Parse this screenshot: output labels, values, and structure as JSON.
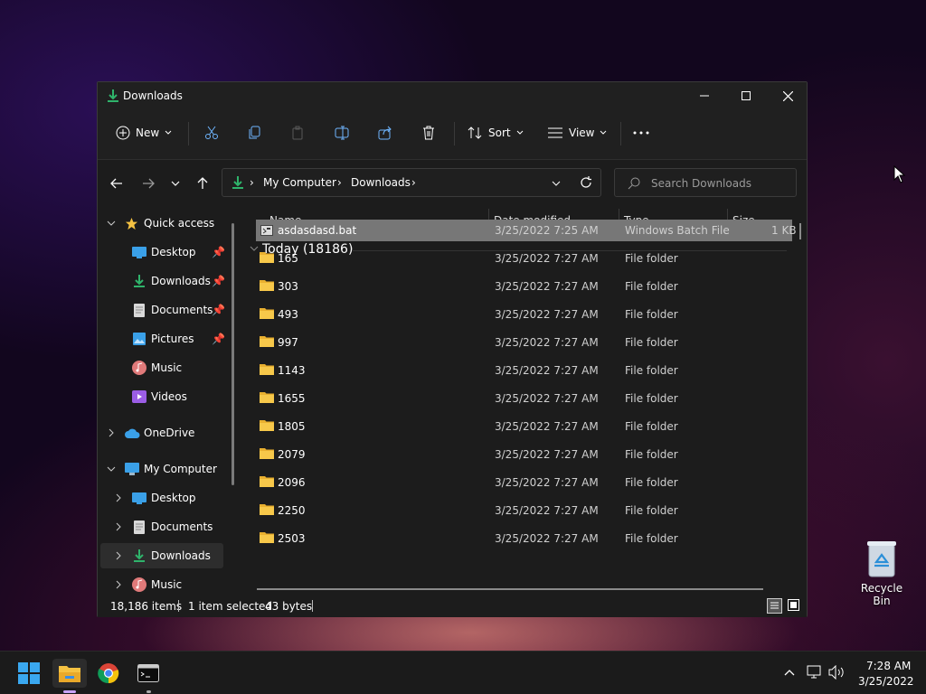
{
  "window": {
    "title": "Downloads"
  },
  "toolbar": {
    "new_label": "New",
    "sort_label": "Sort",
    "view_label": "View"
  },
  "address": {
    "segments": [
      "My Computer",
      "Downloads"
    ]
  },
  "search": {
    "placeholder": "Search Downloads"
  },
  "sidebar": {
    "quick_access": "Quick access",
    "items": [
      {
        "label": "Desktop",
        "pinned": true
      },
      {
        "label": "Downloads",
        "pinned": true
      },
      {
        "label": "Documents",
        "pinned": true
      },
      {
        "label": "Pictures",
        "pinned": true
      },
      {
        "label": "Music",
        "pinned": false
      },
      {
        "label": "Videos",
        "pinned": false
      }
    ],
    "onedrive": "OneDrive",
    "my_computer": "My Computer",
    "computer_items": [
      "Desktop",
      "Documents",
      "Downloads",
      "Music"
    ]
  },
  "columns": {
    "name": "Name",
    "date": "Date modified",
    "type": "Type",
    "size": "Size"
  },
  "group": {
    "title": "Today (18186)"
  },
  "files": [
    {
      "name": "asdasdasd.bat",
      "date": "3/25/2022 7:25 AM",
      "type": "Windows Batch File",
      "size": "1 KB"
    },
    {
      "name": "165",
      "date": "3/25/2022 7:27 AM",
      "type": "File folder",
      "size": ""
    },
    {
      "name": "303",
      "date": "3/25/2022 7:27 AM",
      "type": "File folder",
      "size": ""
    },
    {
      "name": "493",
      "date": "3/25/2022 7:27 AM",
      "type": "File folder",
      "size": ""
    },
    {
      "name": "997",
      "date": "3/25/2022 7:27 AM",
      "type": "File folder",
      "size": ""
    },
    {
      "name": "1143",
      "date": "3/25/2022 7:27 AM",
      "type": "File folder",
      "size": ""
    },
    {
      "name": "1655",
      "date": "3/25/2022 7:27 AM",
      "type": "File folder",
      "size": ""
    },
    {
      "name": "1805",
      "date": "3/25/2022 7:27 AM",
      "type": "File folder",
      "size": ""
    },
    {
      "name": "2079",
      "date": "3/25/2022 7:27 AM",
      "type": "File folder",
      "size": ""
    },
    {
      "name": "2096",
      "date": "3/25/2022 7:27 AM",
      "type": "File folder",
      "size": ""
    },
    {
      "name": "2250",
      "date": "3/25/2022 7:27 AM",
      "type": "File folder",
      "size": ""
    },
    {
      "name": "2503",
      "date": "3/25/2022 7:27 AM",
      "type": "File folder",
      "size": ""
    }
  ],
  "status": {
    "items": "18,186 items",
    "selected": "1 item selected",
    "bytes": "43 bytes"
  },
  "taskbar": {
    "time": "7:28 AM",
    "date": "3/25/2022"
  },
  "desktop": {
    "recycle_bin": "Recycle Bin"
  },
  "colors": {
    "accent_green": "#2fb36b",
    "folder_yellow": "#f5c242",
    "selection": "#777777"
  }
}
